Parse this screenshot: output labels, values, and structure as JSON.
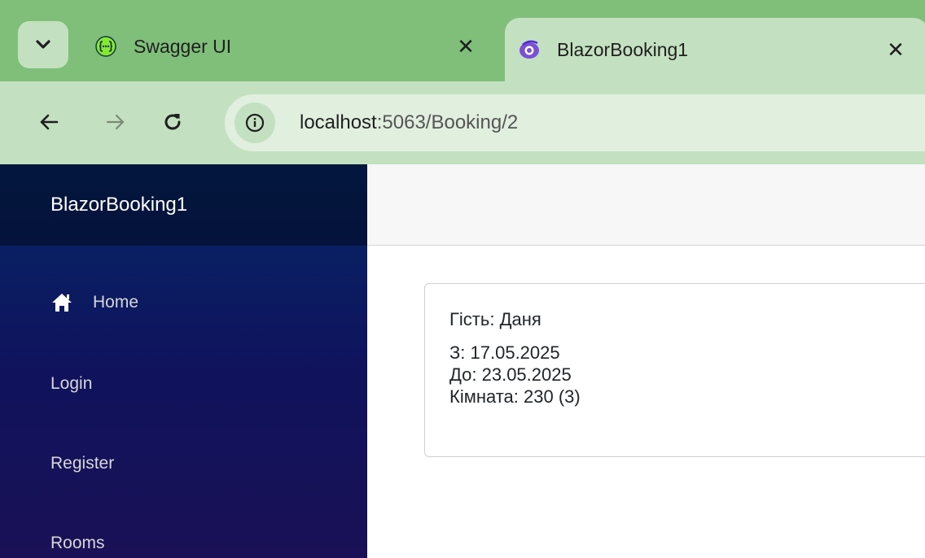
{
  "browser": {
    "tabs": [
      {
        "title": "Swagger UI",
        "icon": "swagger-icon",
        "active": false
      },
      {
        "title": "BlazorBooking1",
        "icon": "blazor-icon",
        "active": true
      }
    ],
    "close_glyph": "✕",
    "address": {
      "host": "localhost",
      "path": ":5063/Booking/2"
    }
  },
  "app": {
    "brand": "BlazorBooking1",
    "nav": [
      {
        "label": "Home",
        "icon": "home-icon"
      },
      {
        "label": "Login"
      },
      {
        "label": "Register"
      },
      {
        "label": "Rooms"
      }
    ]
  },
  "booking": {
    "guest": "Гість: Даня",
    "from": "З: 17.05.2025",
    "to": "До: 23.05.2025",
    "room": "Кімната: 230 (3)"
  },
  "colors": {
    "tabstrip": "#7fbf7a",
    "toolbar": "#c3e1c0",
    "sidebar_top": "#052767",
    "sidebar_bottom": "#1a1156"
  }
}
